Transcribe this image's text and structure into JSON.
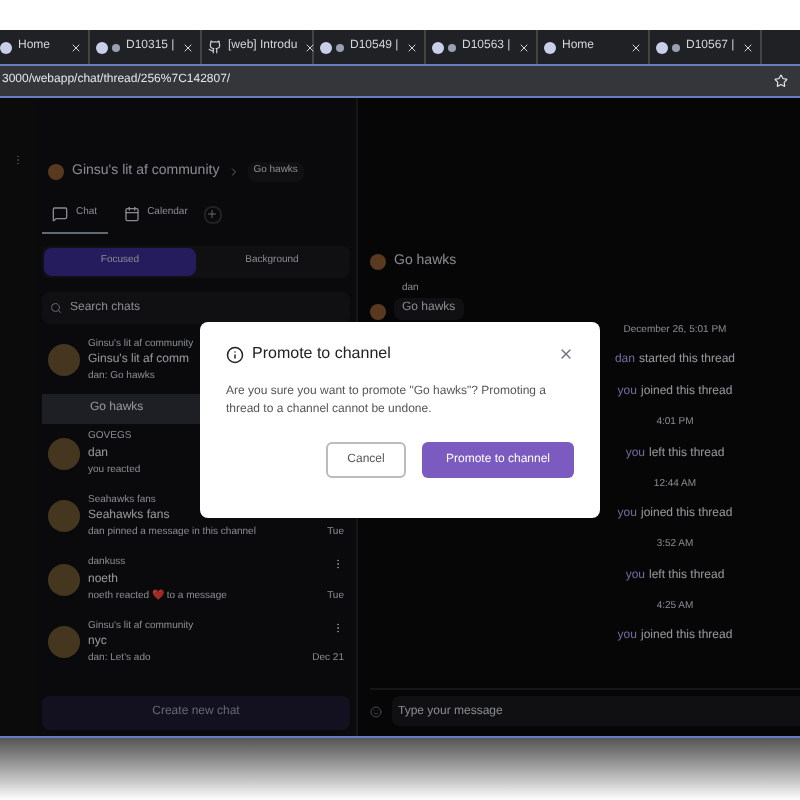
{
  "browser": {
    "tabs": [
      {
        "label": "Home",
        "kind": "app"
      },
      {
        "label": "D10315 |",
        "kind": "task"
      },
      {
        "label": "[web] Introdu",
        "kind": "github"
      },
      {
        "label": "D10549 |",
        "kind": "task"
      },
      {
        "label": "D10563 |",
        "kind": "task"
      },
      {
        "label": "Home",
        "kind": "app"
      },
      {
        "label": "D10567 |",
        "kind": "task"
      }
    ],
    "url": "3000/webapp/chat/thread/256%7C142807/"
  },
  "header": {
    "community": "Ginsu's lit af community",
    "thread": "Go hawks"
  },
  "nav_tabs": [
    {
      "label": "Chat",
      "kind": "chat",
      "selected": true
    },
    {
      "label": "Calendar",
      "kind": "calendar",
      "selected": false
    }
  ],
  "segments": [
    {
      "label": "Focused",
      "selected": true
    },
    {
      "label": "Background",
      "selected": false
    }
  ],
  "search": {
    "placeholder": "Search chats"
  },
  "chats": [
    {
      "group": "Ginsu's lit af community",
      "name": "Ginsu's lit af comm",
      "preview": "dan: Go hawks",
      "children": [
        {
          "label": "Go hawks",
          "selected": true
        }
      ]
    },
    {
      "group": "GOVEGS",
      "name": "dan",
      "preview": "you reacted"
    },
    {
      "group": "Seahawks fans",
      "name": "Seahawks fans",
      "preview": "dan pinned a message in this channel",
      "time": "Tue"
    },
    {
      "group": "dankuss",
      "name": "noeth",
      "preview": "noeth reacted ❤️ to a message",
      "time": "Tue",
      "menu": true
    },
    {
      "group": "Ginsu's lit af community",
      "name": "nyc",
      "preview": "dan: Let's ado",
      "time": "Dec 21",
      "menu": true
    }
  ],
  "create_button": "Create new chat",
  "thread": {
    "title": "Go hawks",
    "message": {
      "author": "dan",
      "text": "Go hawks"
    },
    "events": [
      {
        "kind": "time",
        "text": "December 26, 5:01 PM"
      },
      {
        "kind": "event",
        "actor": "dan",
        "text": "started this thread"
      },
      {
        "kind": "event",
        "actor": "you",
        "text": "joined this thread"
      },
      {
        "kind": "time",
        "text": "4:01 PM"
      },
      {
        "kind": "event",
        "actor": "you",
        "text": "left this thread"
      },
      {
        "kind": "time",
        "text": "12:44 AM"
      },
      {
        "kind": "event",
        "actor": "you",
        "text": "joined this thread"
      },
      {
        "kind": "time",
        "text": "3:52 AM"
      },
      {
        "kind": "event",
        "actor": "you",
        "text": "left this thread"
      },
      {
        "kind": "time",
        "text": "4:25 AM"
      },
      {
        "kind": "event",
        "actor": "you",
        "text": "joined this thread"
      }
    ],
    "input_placeholder": "Type your message"
  },
  "dialog": {
    "title": "Promote to channel",
    "body": "Are you sure you want to promote \"Go hawks\"? Promoting a thread to a channel cannot be undone.",
    "cancel": "Cancel",
    "confirm": "Promote to channel"
  }
}
